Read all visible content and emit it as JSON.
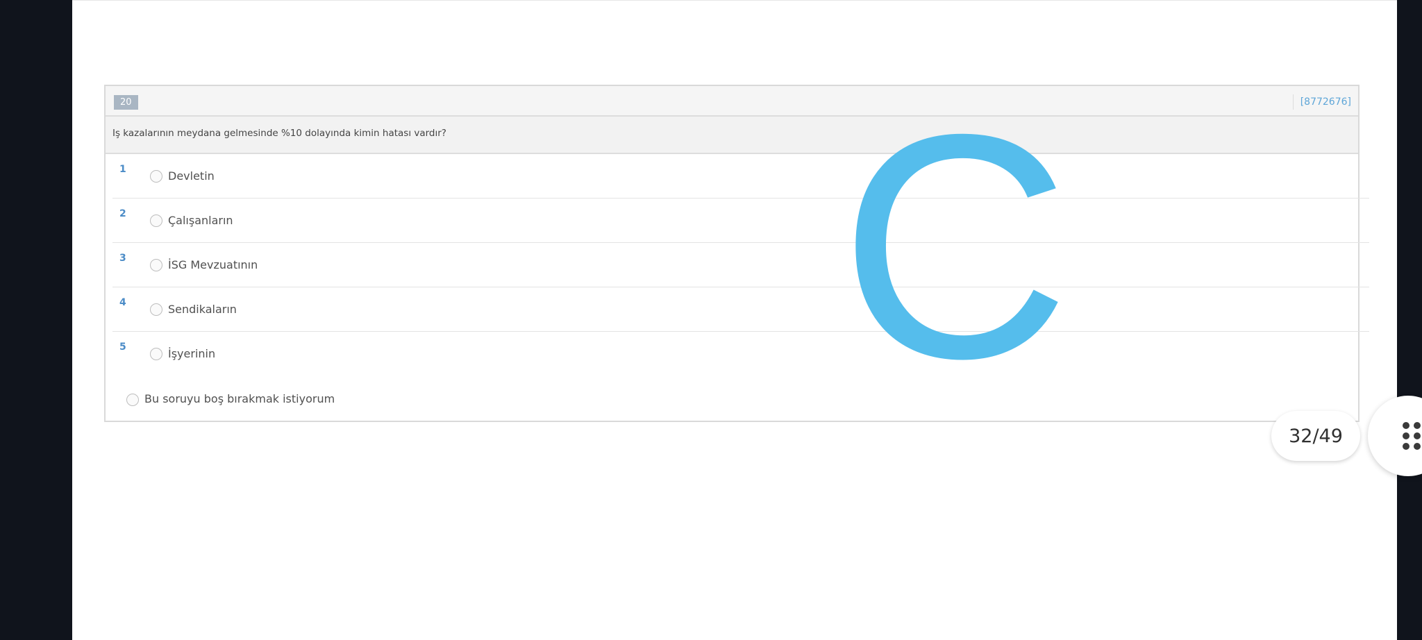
{
  "question": {
    "number": "20",
    "id": "[8772676]",
    "text": "Iş kazalarının meydana gelmesinde %10 dolayında kimin hatası vardır?",
    "options": [
      {
        "num": "1",
        "label": "Devletin"
      },
      {
        "num": "2",
        "label": "Çalışanların"
      },
      {
        "num": "3",
        "label": "İSG Mevzuatının"
      },
      {
        "num": "4",
        "label": "Sendikaların"
      },
      {
        "num": "5",
        "label": "İşyerinin"
      }
    ],
    "skip_label": "Bu soruyu boş bırakmak istiyorum"
  },
  "overlay": {
    "answer_letter": "C",
    "answer_color": "#55bdec"
  },
  "viewer": {
    "page_counter": "32/49",
    "menu_icon": "grid-dots-icon"
  }
}
